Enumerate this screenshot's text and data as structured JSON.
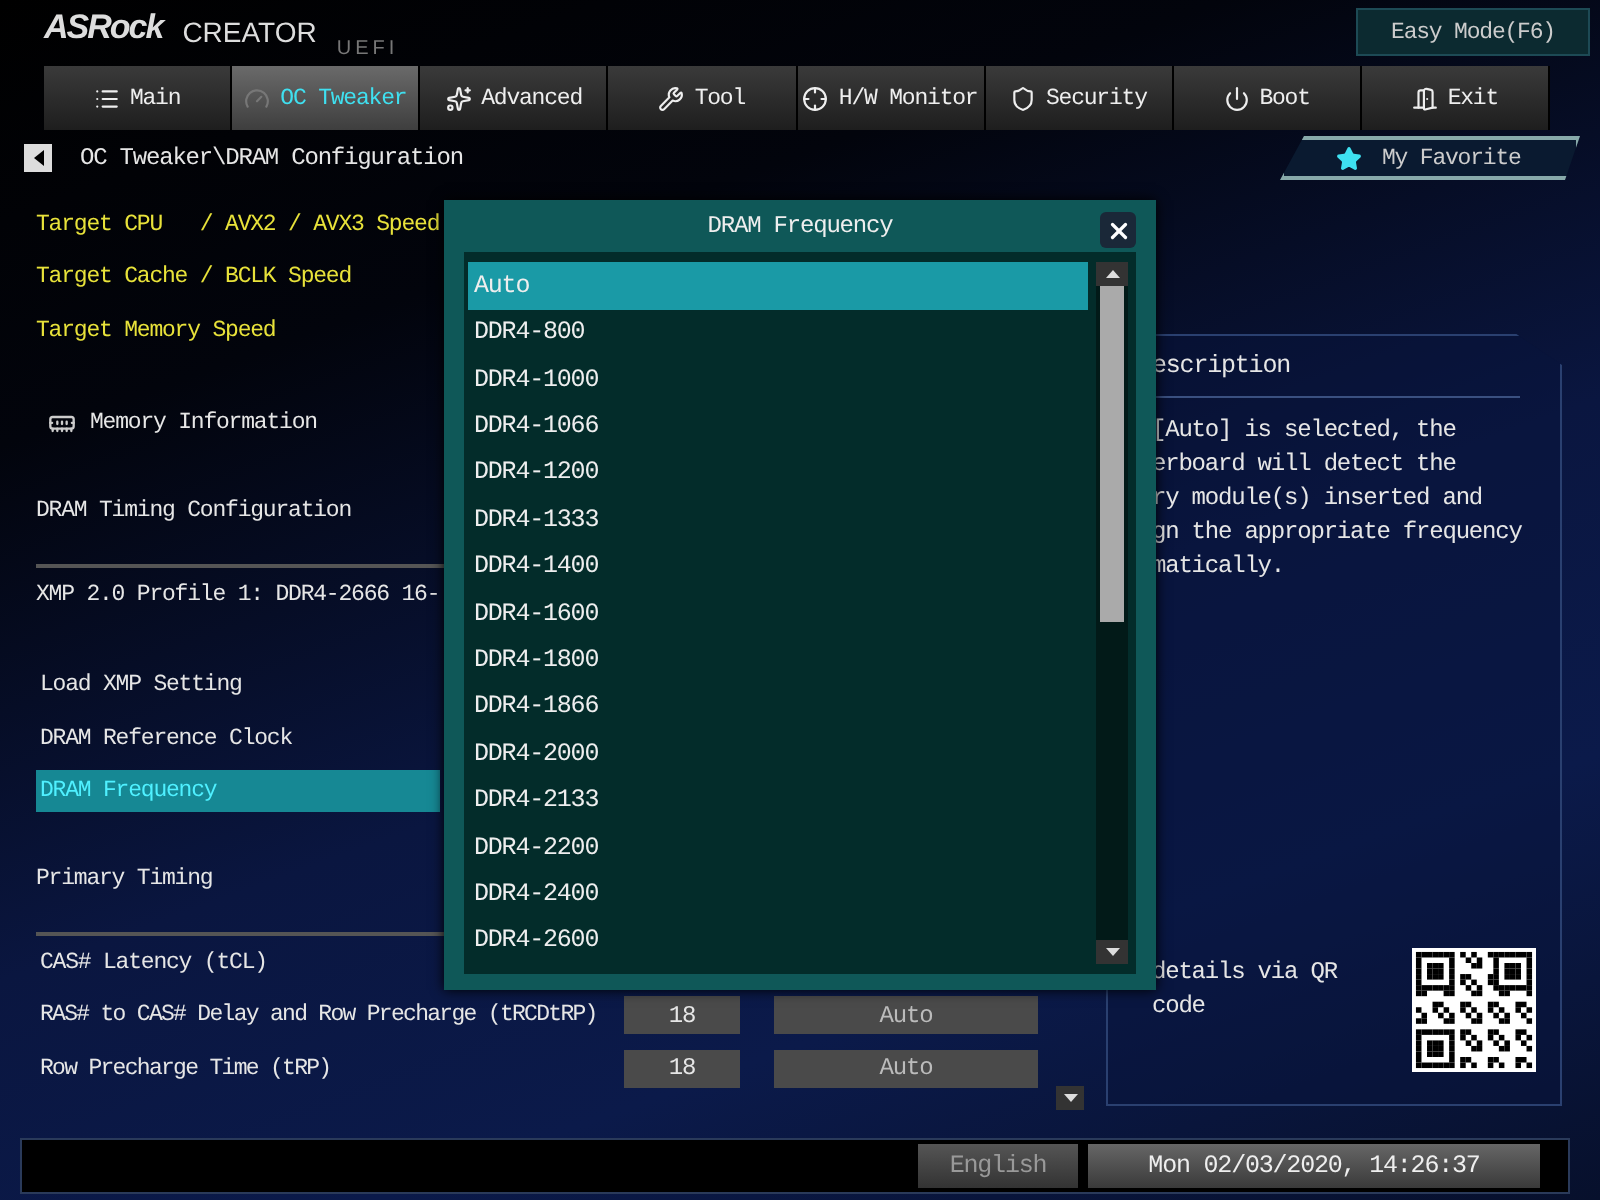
{
  "header": {
    "brand": "ASRock",
    "product": "CREATOR",
    "edition": "UEFI",
    "mode_button": "Easy Mode(F6)"
  },
  "tabs": [
    {
      "label": "Main",
      "selected": false
    },
    {
      "label": "OC Tweaker",
      "selected": true
    },
    {
      "label": "Advanced",
      "selected": false
    },
    {
      "label": "Tool",
      "selected": false
    },
    {
      "label": "H/W Monitor",
      "selected": false
    },
    {
      "label": "Security",
      "selected": false
    },
    {
      "label": "Boot",
      "selected": false
    },
    {
      "label": "Exit",
      "selected": false
    }
  ],
  "breadcrumb": {
    "path": "OC Tweaker\\DRAM Configuration"
  },
  "favorite": {
    "label": "My Favorite"
  },
  "settings": [
    {
      "kind": "target",
      "label": "Target CPU   / AVX2 / AVX3 Speed"
    },
    {
      "kind": "target",
      "label": "Target Cache / BCLK Speed"
    },
    {
      "kind": "target",
      "label": "Target Memory Speed"
    },
    {
      "kind": "link",
      "label": "Memory Information"
    },
    {
      "kind": "heading",
      "label": "DRAM Timing Configuration"
    },
    {
      "kind": "info",
      "label": "XMP 2.0 Profile 1: DDR4-2666 16-"
    },
    {
      "kind": "option",
      "label": "Load XMP Setting",
      "selected": false
    },
    {
      "kind": "option",
      "label": "DRAM Reference Clock",
      "selected": false
    },
    {
      "kind": "option",
      "label": "DRAM Frequency",
      "selected": true
    },
    {
      "kind": "heading",
      "label": "Primary Timing"
    },
    {
      "kind": "option",
      "label": "CAS# Latency (tCL)",
      "selected": false
    },
    {
      "kind": "option",
      "label": "RAS# to CAS# Delay and Row Precharge (tRCDtRP)",
      "value": "18",
      "setting": "Auto",
      "selected": false
    },
    {
      "kind": "option",
      "label": "Row Precharge Time (tRP)",
      "value": "18",
      "setting": "Auto",
      "selected": false
    }
  ],
  "dialog": {
    "title": "DRAM Frequency",
    "options": [
      {
        "label": "Auto",
        "selected": true
      },
      {
        "label": "DDR4-800",
        "selected": false
      },
      {
        "label": "DDR4-1000",
        "selected": false
      },
      {
        "label": "DDR4-1066",
        "selected": false
      },
      {
        "label": "DDR4-1200",
        "selected": false
      },
      {
        "label": "DDR4-1333",
        "selected": false
      },
      {
        "label": "DDR4-1400",
        "selected": false
      },
      {
        "label": "DDR4-1600",
        "selected": false
      },
      {
        "label": "DDR4-1800",
        "selected": false
      },
      {
        "label": "DDR4-1866",
        "selected": false
      },
      {
        "label": "DDR4-2000",
        "selected": false
      },
      {
        "label": "DDR4-2133",
        "selected": false
      },
      {
        "label": "DDR4-2200",
        "selected": false
      },
      {
        "label": "DDR4-2400",
        "selected": false
      },
      {
        "label": "DDR4-2600",
        "selected": false
      }
    ]
  },
  "description": {
    "title": "escription",
    "lines": [
      "[Auto] is selected, the",
      "erboard will detect the",
      "ry module(s) inserted and",
      "gn the appropriate frequency",
      "matically."
    ],
    "qr_note": [
      "details via QR",
      "code"
    ]
  },
  "status_bar": {
    "language": "English",
    "datetime": "Mon 02/03/2020, 14:26:37"
  }
}
